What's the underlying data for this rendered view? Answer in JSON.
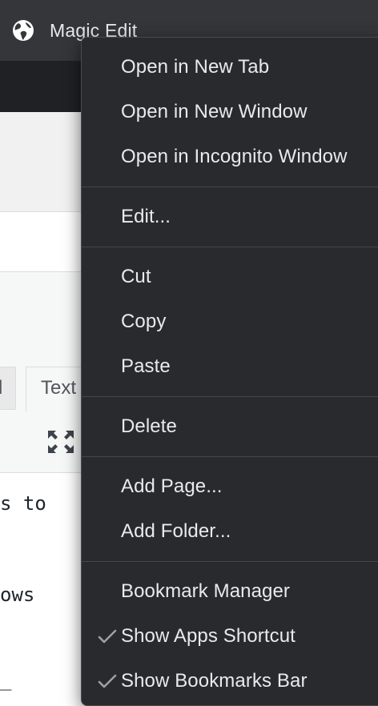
{
  "bookmarks_bar": {
    "items": [
      {
        "label": "Magic Edit",
        "icon": "globe-icon"
      }
    ]
  },
  "editor": {
    "tabs": [
      {
        "label": "l"
      },
      {
        "label": "Text"
      }
    ],
    "code_lines": [
      "s to",
      "ows",
      "_"
    ]
  },
  "context_menu": {
    "groups": [
      {
        "items": [
          {
            "label": "Open in New Tab"
          },
          {
            "label": "Open in New Window"
          },
          {
            "label": "Open in Incognito Window"
          }
        ]
      },
      {
        "items": [
          {
            "label": "Edit..."
          }
        ]
      },
      {
        "items": [
          {
            "label": "Cut"
          },
          {
            "label": "Copy"
          },
          {
            "label": "Paste"
          }
        ]
      },
      {
        "items": [
          {
            "label": "Delete"
          }
        ]
      },
      {
        "items": [
          {
            "label": "Add Page..."
          },
          {
            "label": "Add Folder..."
          }
        ]
      },
      {
        "items": [
          {
            "label": "Bookmark Manager"
          },
          {
            "label": "Show Apps Shortcut",
            "checked": true
          },
          {
            "label": "Show Bookmarks Bar",
            "checked": true
          }
        ]
      }
    ]
  },
  "colors": {
    "menu_background": "#292a2d",
    "menu_text": "#e8eaed",
    "menu_separator": "#45464a",
    "bookmarks_bar": "#35363a",
    "check_mark": "#9aa0a6"
  }
}
